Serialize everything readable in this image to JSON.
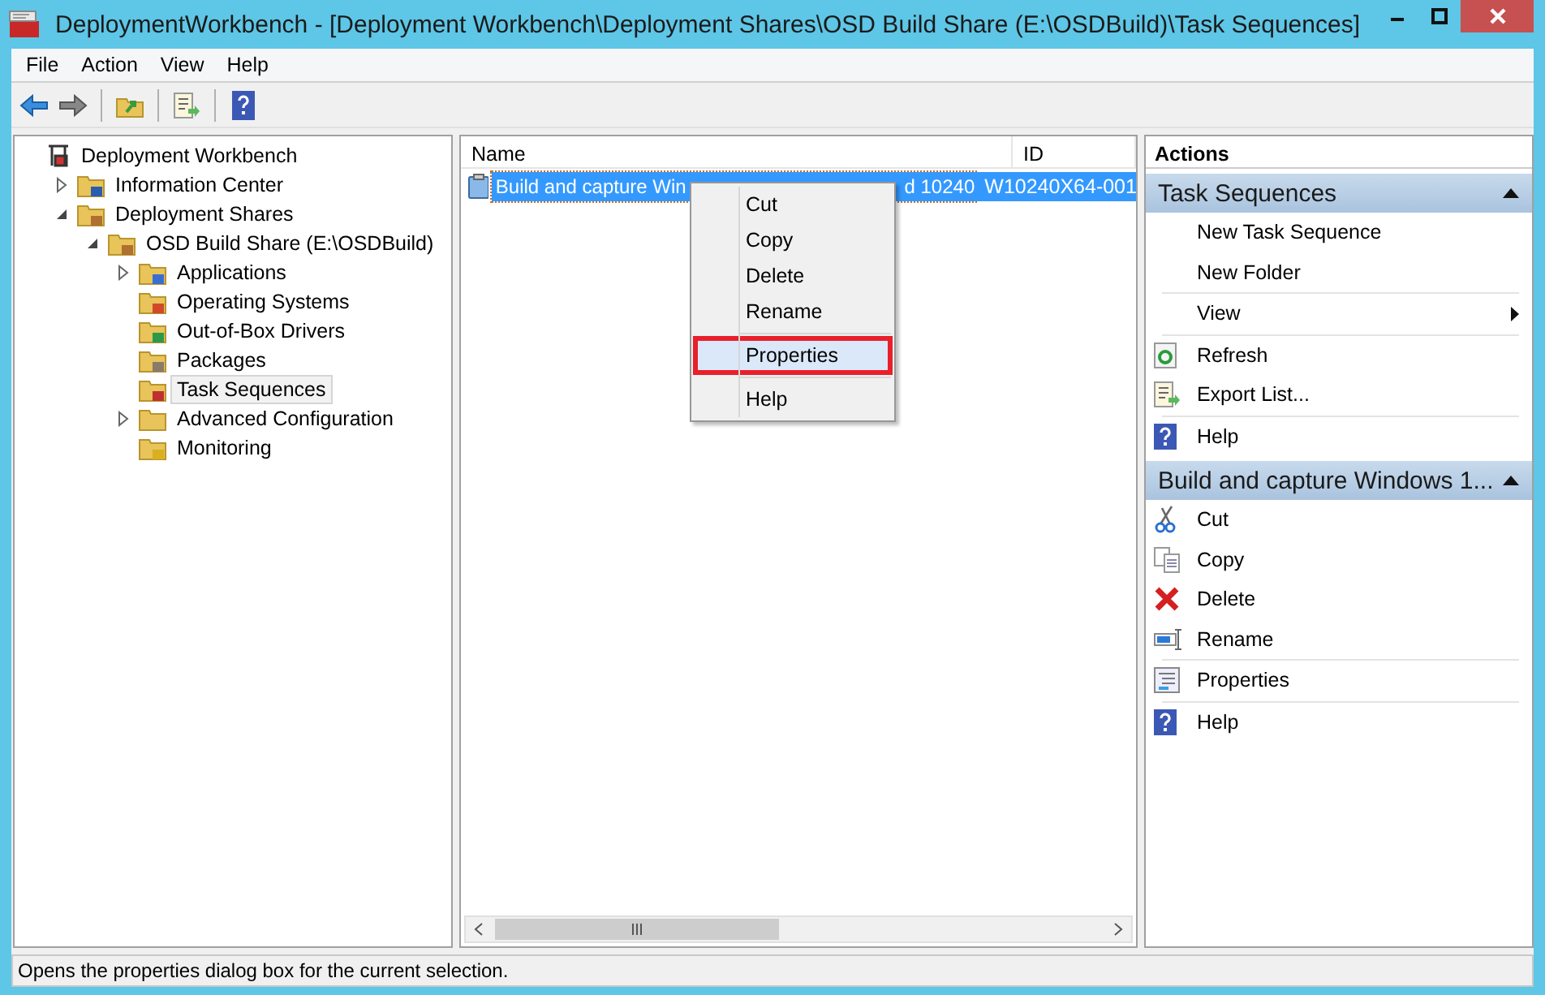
{
  "window": {
    "title": "DeploymentWorkbench - [Deployment Workbench\\Deployment Shares\\OSD Build Share (E:\\OSDBuild)\\Task Sequences]"
  },
  "menu": [
    {
      "label": "File"
    },
    {
      "label": "Action"
    },
    {
      "label": "View"
    },
    {
      "label": "Help"
    }
  ],
  "tree": [
    {
      "label": "Deployment Workbench",
      "kind": "root",
      "selected": false,
      "children": [
        {
          "label": "Information Center",
          "kind": "info",
          "expanded": false,
          "selected": false
        },
        {
          "label": "Deployment Shares",
          "kind": "share",
          "expanded": true,
          "selected": false,
          "children": [
            {
              "label": "OSD Build Share (E:\\OSDBuild)",
              "kind": "share",
              "expanded": true,
              "selected": false,
              "children": [
                {
                  "label": "Applications",
                  "kind": "apps",
                  "expanded": false,
                  "selected": false
                },
                {
                  "label": "Operating Systems",
                  "kind": "os",
                  "selected": false
                },
                {
                  "label": "Out-of-Box Drivers",
                  "kind": "drivers",
                  "selected": false
                },
                {
                  "label": "Packages",
                  "kind": "packages",
                  "selected": false
                },
                {
                  "label": "Task Sequences",
                  "kind": "tasks",
                  "selected": true
                },
                {
                  "label": "Advanced Configuration",
                  "kind": "folder",
                  "expanded": false,
                  "selected": false
                },
                {
                  "label": "Monitoring",
                  "kind": "monitoring",
                  "selected": false
                }
              ]
            }
          ]
        }
      ]
    }
  ],
  "list": {
    "columns": [
      "Name",
      "ID"
    ],
    "rows": [
      {
        "name_start": "Build and capture Win",
        "name_end": "d 10240",
        "id": "W10240X64-001",
        "selected": true
      }
    ]
  },
  "context_menu": [
    {
      "kind": "item",
      "label": "Cut",
      "selected": false
    },
    {
      "kind": "item",
      "label": "Copy",
      "selected": false
    },
    {
      "kind": "item",
      "label": "Delete",
      "selected": false
    },
    {
      "kind": "item",
      "label": "Rename",
      "selected": false
    },
    {
      "kind": "separator"
    },
    {
      "kind": "item",
      "label": "Properties",
      "selected": true
    },
    {
      "kind": "separator"
    },
    {
      "kind": "item",
      "label": "Help",
      "selected": false
    }
  ],
  "actions": {
    "title": "Actions",
    "sections": [
      {
        "title": "Task Sequences",
        "expanded": true,
        "items": [
          {
            "kind": "plain",
            "label": "New Task Sequence"
          },
          {
            "kind": "plain",
            "label": "New Folder"
          },
          {
            "kind": "separator"
          },
          {
            "kind": "plain",
            "label": "View",
            "submenu": true
          },
          {
            "kind": "separator"
          },
          {
            "kind": "refresh",
            "label": "Refresh"
          },
          {
            "kind": "export",
            "label": "Export List..."
          },
          {
            "kind": "separator"
          },
          {
            "kind": "help",
            "label": "Help"
          }
        ]
      },
      {
        "title": "Build and capture Windows 1...",
        "expanded": true,
        "items": [
          {
            "kind": "cut",
            "label": "Cut"
          },
          {
            "kind": "copy",
            "label": "Copy"
          },
          {
            "kind": "delete",
            "label": "Delete"
          },
          {
            "kind": "rename",
            "label": "Rename"
          },
          {
            "kind": "separator"
          },
          {
            "kind": "properties",
            "label": "Properties"
          },
          {
            "kind": "separator"
          },
          {
            "kind": "help",
            "label": "Help"
          }
        ]
      }
    ]
  },
  "status_bar": {
    "text": "Opens the properties dialog box for the current selection."
  }
}
